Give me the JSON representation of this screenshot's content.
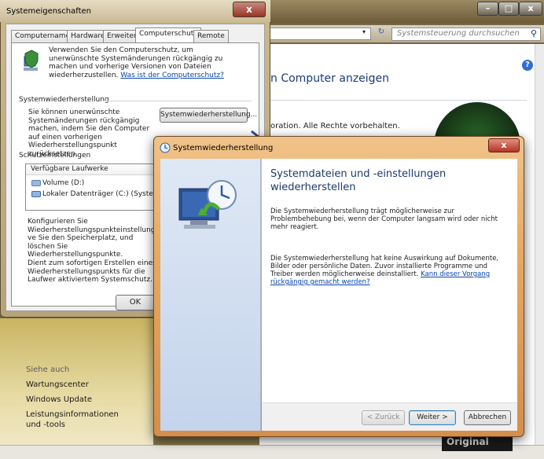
{
  "background_window": {
    "search_placeholder": "Systemsteuerung durchsuchen",
    "content_title": "n Computer anzeigen",
    "content_text": "oration. Alle Rechte vorbehalten.",
    "help": "?",
    "caption": {
      "minimize": "–",
      "maximize": "□",
      "close": "x"
    },
    "refresh_glyph": "↻",
    "dropdown_glyph": "▾",
    "search_glyph": "⚲"
  },
  "side_panel": {
    "title": "Siehe auch",
    "links": [
      "Wartungscenter",
      "Windows Update",
      "Leistungsinformationen und -tools"
    ]
  },
  "bottom_badge": "Original",
  "system_properties": {
    "title": "Systemeigenschaften",
    "close": "x",
    "tabs": [
      "Computername",
      "Hardware",
      "Erweitert",
      "Computerschutz",
      "Remote"
    ],
    "active_tab": "Computerschutz",
    "intro": "Verwenden Sie den Computerschutz, um unerwünschte Systemänderungen rückgängig zu machen und vorherige Versionen von Dateien wiederherzustellen.",
    "intro_link": "Was ist der Computerschutz?",
    "restore_section_title": "Systemwiederherstellung",
    "restore_section_text": "Sie können unerwünschte Systemänderungen rückgängig machen, indem Sie den Computer auf einen vorherigen Wiederherstellungspunkt zurücksetzen.",
    "restore_button": "Systemwiederherstellung...",
    "protection_title": "Schutzeinstellungen",
    "drives_header": "Verfügbare Laufwerke",
    "drives": [
      "Volume (D:)",
      "Lokaler Datenträger (C:) (System)"
    ],
    "configure_text": "Konfigurieren Sie Wiederherstellungspunkteinstellungen, ve Sie den Speicherplatz, und löschen Sie Wiederherstellungspunkte.",
    "create_text": "Dient zum sofortigen Erstellen eines Wiederherstellungspunkts für die Laufwer aktiviertem Systemschutz.",
    "ok_button": "OK"
  },
  "wizard": {
    "title": "Systemwiederherstellung",
    "close": "x",
    "heading": "Systemdateien und -einstellungen wiederherstellen",
    "paragraph1": "Die Systemwiederherstellung trägt möglicherweise zur Problembehebung bei, wenn der Computer langsam wird oder nicht mehr reagiert.",
    "paragraph2": "Die Systemwiederherstellung hat keine Auswirkung auf Dokumente, Bilder oder persönliche Daten. Zuvor installierte Programme und Treiber werden möglicherweise deinstalliert.",
    "paragraph2_link": "Kann dieser Vorgang rückgängig gemacht werden?",
    "back_button": "< Zurück",
    "next_button": "Weiter >",
    "cancel_button": "Abbrechen"
  }
}
